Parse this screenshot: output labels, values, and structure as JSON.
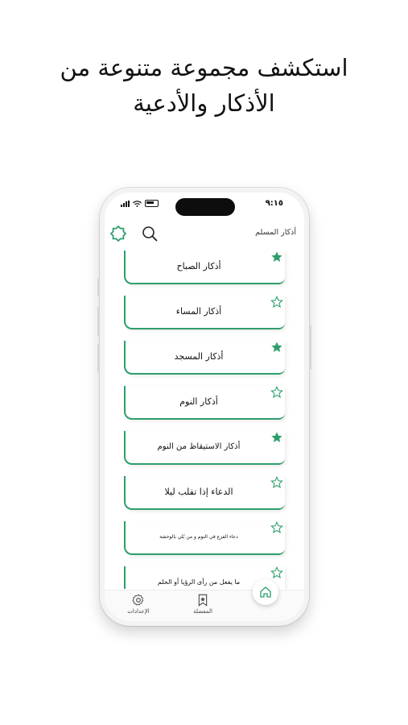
{
  "headline": {
    "line1": "استكشف مجموعة متنوعة من",
    "line2": "الأذكار والأدعية"
  },
  "status_bar": {
    "time": "٩:١٥"
  },
  "app_bar": {
    "title": "أذكار المسلم",
    "search_icon": "search-icon",
    "theme_icon": "moon-badge-icon"
  },
  "items": [
    {
      "label": "أذكار الصباح",
      "favorite": true
    },
    {
      "label": "أذكار المساء",
      "favorite": false
    },
    {
      "label": "أذكار المسجد",
      "favorite": true
    },
    {
      "label": "أذكار النوم",
      "favorite": false
    },
    {
      "label": "أذكار الاستيقاظ من النوم",
      "favorite": true
    },
    {
      "label": "الدعاء إذا تقلب ليلا",
      "favorite": false
    },
    {
      "label": "دعاء الفزع في النوم و من بُلي بالوحشة",
      "favorite": false
    },
    {
      "label": "ما يفعل من رأى الرؤيا أو الحلم",
      "favorite": false
    }
  ],
  "tab_bar": {
    "settings_label": "الإعدادات",
    "favorites_label": "المفضلة",
    "home_icon": "home-icon"
  },
  "colors": {
    "accent": "#2e9e6b",
    "text": "#111111"
  }
}
